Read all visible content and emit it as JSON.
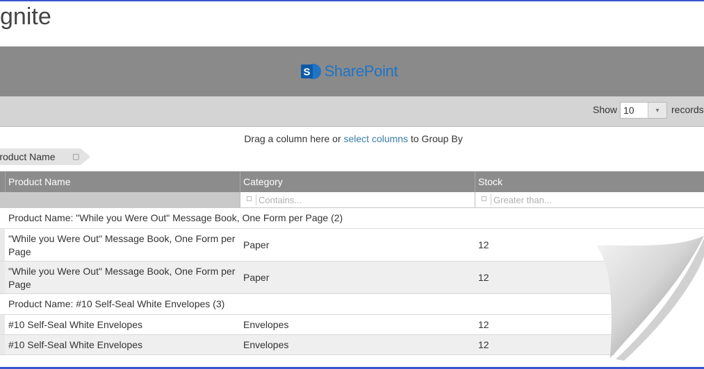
{
  "page_title": "gnite",
  "banner": {
    "logo_text": "SharePoint",
    "logo_icon": "sharepoint-icon"
  },
  "toolbar": {
    "show_label": "Show",
    "page_size_value": "10",
    "records_label": "records"
  },
  "group_panel": {
    "hint_before": "Drag a column here or",
    "hint_link": "select columns",
    "hint_after": "to Group By",
    "chip_label": "Product Name"
  },
  "grid": {
    "columns": [
      "Product Name",
      "Category",
      "Stock"
    ],
    "filter_placeholders": {
      "category": "Contains...",
      "stock": "Greater than..."
    },
    "groups": [
      {
        "header": "Product Name: \"While you Were Out\" Message Book, One Form per Page (2)",
        "rows": [
          {
            "name": "\"While you Were Out\" Message Book, One Form per Page",
            "category": "Paper",
            "stock": "12"
          },
          {
            "name": "\"While you Were Out\" Message Book, One Form per Page",
            "category": "Paper",
            "stock": "12"
          }
        ]
      },
      {
        "header": "Product Name: #10 Self-Seal White Envelopes (3)",
        "rows": [
          {
            "name": "#10 Self-Seal White Envelopes",
            "category": "Envelopes",
            "stock": "12"
          },
          {
            "name": "#10 Self-Seal White Envelopes",
            "category": "Envelopes",
            "stock": "12"
          }
        ]
      }
    ]
  },
  "colors": {
    "banner": "#8a8a8a",
    "header": "#8c8c8c",
    "accent_link": "#3a7da8",
    "frame": "#3a55d0",
    "logo": "#1f74c6"
  }
}
